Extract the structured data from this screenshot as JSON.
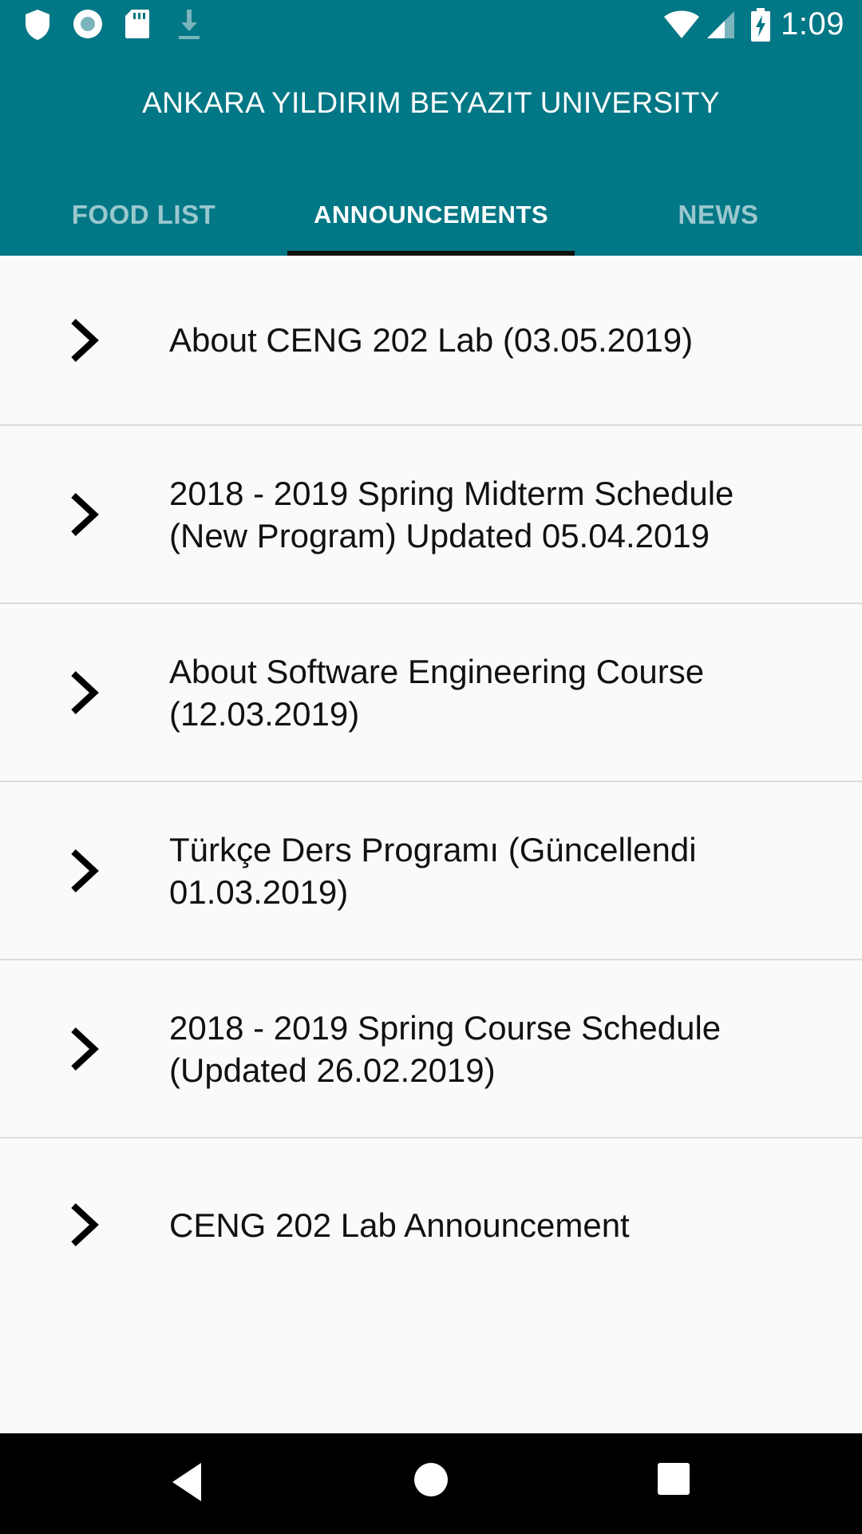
{
  "status_bar": {
    "time": "1:09",
    "left_icons": [
      "shield-icon",
      "record-icon",
      "sd-card-icon",
      "download-icon"
    ],
    "right_icons": [
      "wifi-icon",
      "cell-signal-icon",
      "battery-charging-icon"
    ]
  },
  "app_bar": {
    "title": "ANKARA YILDIRIM BEYAZIT UNIVERSITY",
    "background": "#027785"
  },
  "tabs": [
    {
      "label": "FOOD LIST",
      "active": false
    },
    {
      "label": "ANNOUNCEMENTS",
      "active": true
    },
    {
      "label": "NEWS",
      "active": false
    }
  ],
  "announcements": [
    {
      "title": "About CENG 202 Lab (03.05.2019)",
      "icon": "chevron-right-icon"
    },
    {
      "title": "2018 - 2019 Spring Midterm Schedule (New Program) Updated 05.04.2019",
      "icon": "chevron-right-icon"
    },
    {
      "title": "About Software Engineering Course (12.03.2019)",
      "icon": "chevron-right-icon"
    },
    {
      "title": "Türkçe Ders Programı (Güncellendi 01.03.2019)",
      "icon": "chevron-right-icon"
    },
    {
      "title": "2018 - 2019 Spring Course Schedule (Updated 26.02.2019)",
      "icon": "chevron-right-icon"
    },
    {
      "title": "CENG 202 Lab Announcement",
      "icon": "chevron-right-icon"
    }
  ],
  "nav_bar": {
    "buttons": [
      "back-icon",
      "home-icon",
      "recents-icon"
    ]
  }
}
